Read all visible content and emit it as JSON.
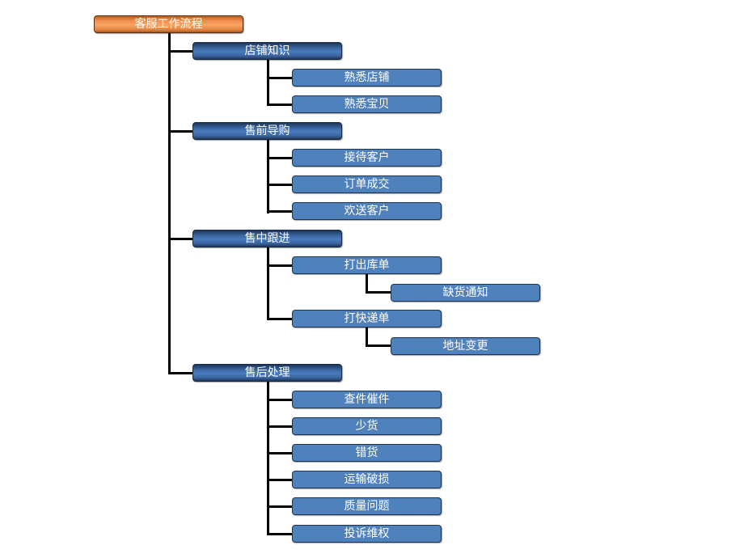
{
  "root": {
    "label": "客服工作流程",
    "color": "#f29150",
    "children": [
      {
        "label": "店铺知识",
        "children": [
          {
            "label": "熟悉店铺",
            "children": []
          },
          {
            "label": "熟悉宝贝",
            "children": []
          }
        ]
      },
      {
        "label": "售前导购",
        "children": [
          {
            "label": "接待客户",
            "children": []
          },
          {
            "label": "订单成交",
            "children": []
          },
          {
            "label": "欢送客户",
            "children": []
          }
        ]
      },
      {
        "label": "售中跟进",
        "children": [
          {
            "label": "打出库单",
            "children": [
              {
                "label": "缺货通知"
              }
            ]
          },
          {
            "label": "打快递单",
            "children": [
              {
                "label": "地址变更"
              }
            ]
          }
        ]
      },
      {
        "label": "售后处理",
        "children": [
          {
            "label": "查件催件",
            "children": []
          },
          {
            "label": "少货",
            "children": []
          },
          {
            "label": "错货",
            "children": []
          },
          {
            "label": "运输破损",
            "children": []
          },
          {
            "label": "质量问题",
            "children": []
          },
          {
            "label": "投诉维权",
            "children": []
          }
        ]
      }
    ]
  },
  "colors": {
    "root": "#f29150",
    "level1": "#3d6aa8",
    "level2": "#4f81bd",
    "connector": "#000000"
  }
}
